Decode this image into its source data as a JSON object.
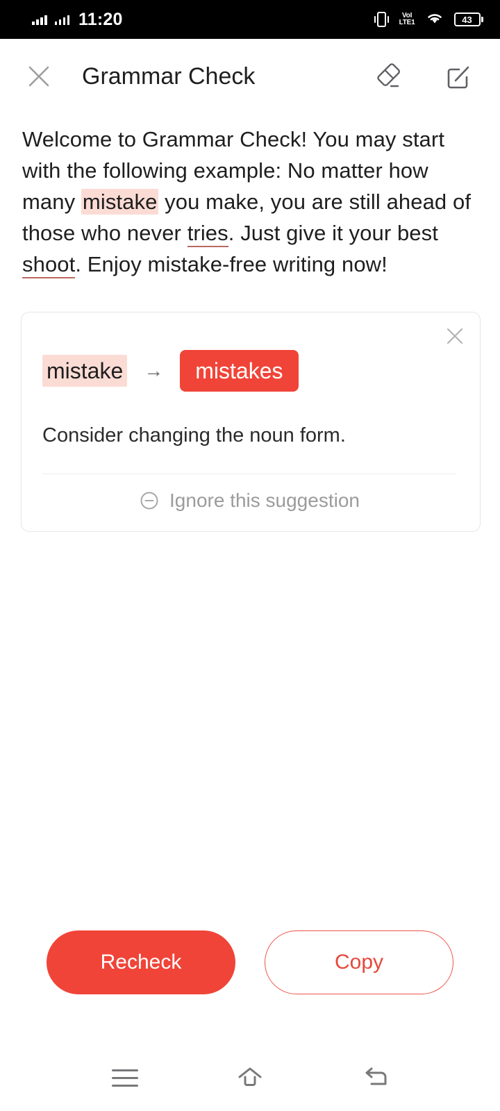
{
  "status_bar": {
    "time": "11:20",
    "signal_1": "signal-bars-icon",
    "signal_2": "signal-bars-icon",
    "vibrate": "vibrate-icon",
    "network_line_1": "VoI",
    "network_line_2": "LTE1",
    "wifi": "wifi-icon",
    "battery_level": "43"
  },
  "header": {
    "title": "Grammar Check",
    "close_icon": "close-icon",
    "eraser_icon": "eraser-icon",
    "compose_icon": "compose-icon"
  },
  "document": {
    "segments": [
      {
        "text": "Welcome to Grammar Check! You may start with the following example: No matter how many ",
        "style": "plain"
      },
      {
        "text": "mistake",
        "style": "highlight"
      },
      {
        "text": " you make, you are still ahead of those who never ",
        "style": "plain"
      },
      {
        "text": "tries",
        "style": "underline-error"
      },
      {
        "text": ". Just give it your best ",
        "style": "plain"
      },
      {
        "text": "shoot",
        "style": "underline-error"
      },
      {
        "text": ". Enjoy mistake-free writing now!",
        "style": "plain"
      }
    ],
    "full_text": "Welcome to Grammar Check! You may start with the following example: No matter how many mistake you make, you are still ahead of those who never tries. Just give it your best shoot. Enjoy mistake-free writing now!"
  },
  "suggestion_card": {
    "original_word": "mistake",
    "arrow": "→",
    "replacement_word": "mistakes",
    "explanation": "Consider changing the noun form.",
    "ignore_label": "Ignore this suggestion",
    "ignore_icon": "minus-circle-icon",
    "close_icon": "close-icon"
  },
  "footer": {
    "recheck_label": "Recheck",
    "copy_label": "Copy"
  },
  "nav_bar": {
    "recents_icon": "menu-icon",
    "home_icon": "home-icon",
    "back_icon": "back-arrow-icon"
  },
  "colors": {
    "accent_red": "#f04438",
    "highlight_pink": "#fbdcd5",
    "error_underline": "#b9675f",
    "muted_text": "#9b9b9b",
    "status_bar_bg": "#000000"
  }
}
